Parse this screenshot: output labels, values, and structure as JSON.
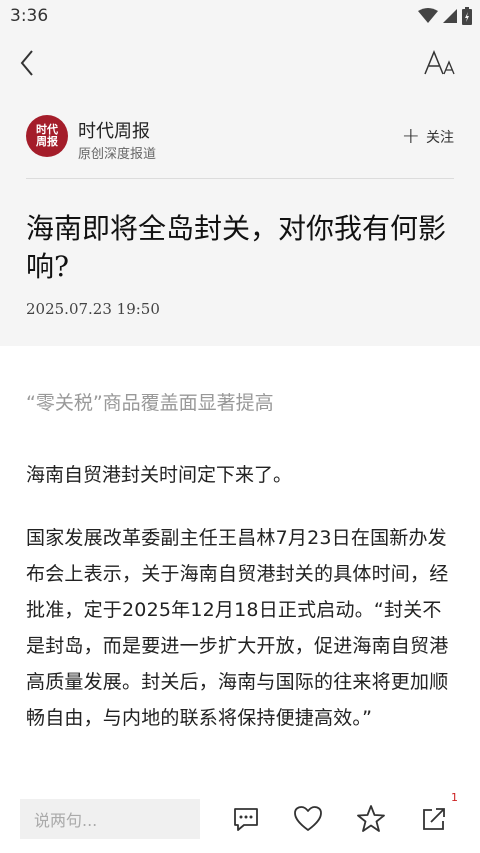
{
  "status_bar": {
    "time": "3:36"
  },
  "toolbar": {
    "back_icon": "chevron-left-icon",
    "font_icon": "font-size-icon"
  },
  "author": {
    "avatar_line1": "时代",
    "avatar_line2": "周报",
    "name": "时代周报",
    "description": "原创深度报道",
    "follow_label": "关注"
  },
  "article": {
    "title": "海南即将全岛封关，对你我有何影响?",
    "date": "2025.07.23 19:50",
    "subtitle": "“零关税”商品覆盖面显著提高",
    "paragraphs": [
      "海南自贸港封关时间定下来了。",
      "国家发展改革委副主任王昌林7月23日在国新办发布会上表示，关于海南自贸港封关的具体时间，经批准，定于2025年12月18日正式启动。“封关不是封岛，而是要进一步扩大开放，促进海南自贸港高质量发展。封关后，海南与国际的往来将更加顺畅自由，与内地的联系将保持便捷高效。”"
    ]
  },
  "bottom_bar": {
    "comment_placeholder": "说两句...",
    "share_badge": "1"
  }
}
